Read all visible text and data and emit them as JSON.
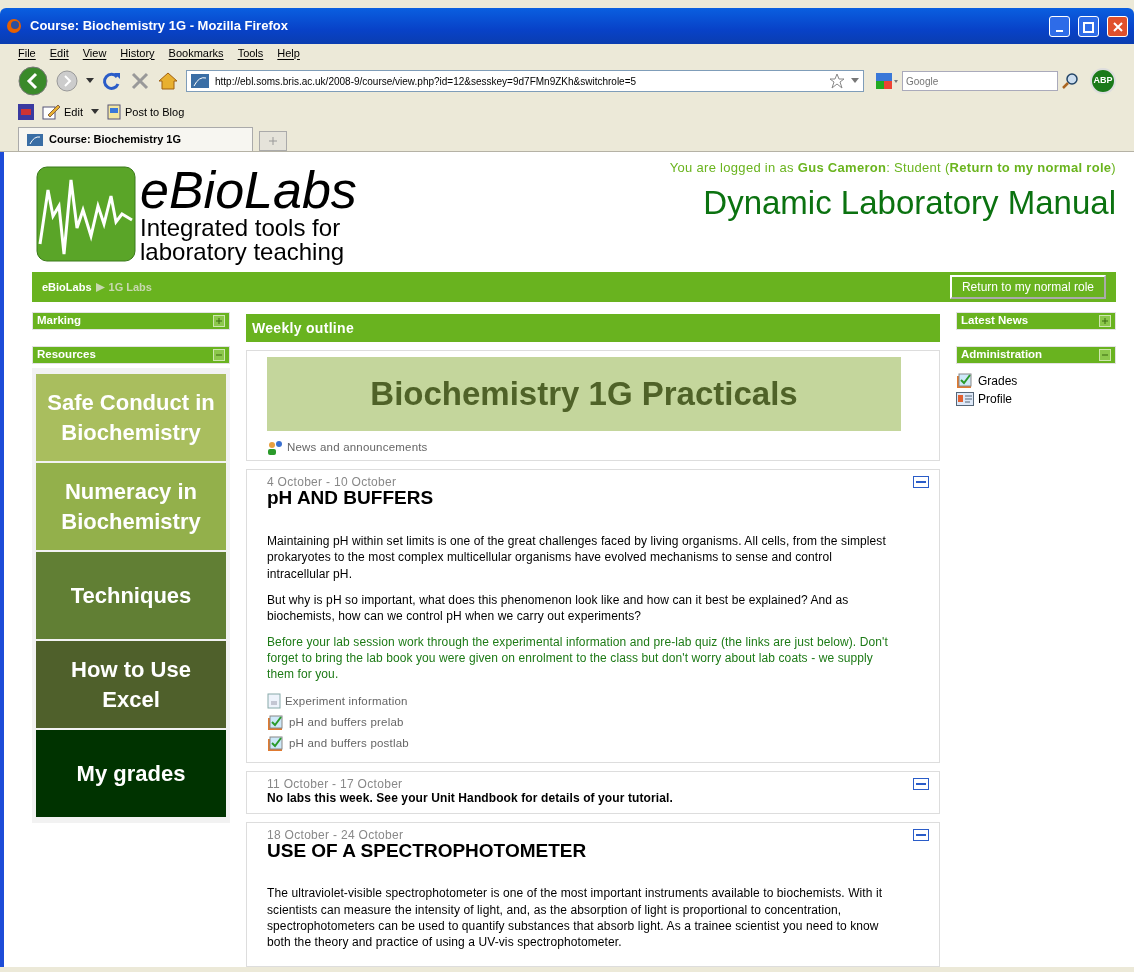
{
  "window": {
    "title": "Course: Biochemistry 1G - Mozilla Firefox"
  },
  "menu": [
    "File",
    "Edit",
    "View",
    "History",
    "Bookmarks",
    "Tools",
    "Help"
  ],
  "toolbar": {
    "url": "http://ebl.soms.bris.ac.uk/2008-9/course/view.php?id=12&sesskey=9d7FMn9ZKh&switchrole=5",
    "search_placeholder": "Google",
    "addon": "ABP"
  },
  "bookmarks": [
    "Edit",
    "Post to Blog"
  ],
  "tabs": [
    {
      "label": "Course: Biochemistry 1G",
      "selected": true
    }
  ],
  "header": {
    "logo_title": "eBioLabs",
    "logo_tagline": [
      "Integrated tools for",
      "laboratory teaching"
    ],
    "login": "You are logged in as **Gus Cameron**: Student (**Return to my normal role**)",
    "site_title": "Dynamic Laboratory Manual"
  },
  "breadcrumb": [
    "eBioLabs",
    "1G Labs"
  ],
  "role_button": "Return to my normal role",
  "left_blocks": [
    {
      "title": "Marking",
      "expanded": false
    },
    {
      "title": "Resources",
      "expanded": true,
      "tiles": [
        {
          "label": "Safe Conduct in Biochemistry",
          "color": "#a9be5e"
        },
        {
          "label": "Numeracy in Biochemistry",
          "color": "#93b04b"
        },
        {
          "label": "Techniques",
          "color": "#617f34"
        },
        {
          "label": "How to Use Excel",
          "color": "#4f602b"
        },
        {
          "label": "My grades",
          "color": "#003300"
        }
      ]
    }
  ],
  "outline": {
    "heading": "Weekly outline",
    "banner": "Biochemistry 1G Practicals",
    "news": "News and announcements",
    "sections": [
      {
        "dates": "4 October - 10 October",
        "title": "pH AND BUFFERS",
        "paragraphs": [
          {
            "kind": "plain",
            "text": "Maintaining pH within set limits is one of the great challenges faced by living organisms. All cells, from the simplest prokaryotes to the most complex multicellular organisms have evolved mechanisms to sense and control intracellular pH."
          },
          {
            "kind": "plain",
            "text": "But why is pH so important, what does this phenomenon look like and how can it best be explained? And as biochemists, how can we control pH when we carry out experiments?"
          },
          {
            "kind": "notice",
            "text": "Before your lab session work through the experimental information and pre-lab quiz (the links are just below). Don't forget to bring the lab book you were given on enrolment to the class but don't worry about lab coats - we supply them for you."
          }
        ],
        "activities": [
          {
            "kind": "page",
            "label": "Experiment information"
          },
          {
            "kind": "quiz",
            "label": "pH and buffers prelab"
          },
          {
            "kind": "quiz",
            "label": "pH and buffers postlab"
          }
        ]
      },
      {
        "dates": "11 October - 17 October",
        "paragraphs": [
          {
            "kind": "note",
            "text": "No labs this week. See your Unit Handbook for details of your tutorial."
          }
        ]
      },
      {
        "dates": "18 October - 24 October",
        "title": "USE OF A SPECTROPHOTOMETER",
        "paragraphs": [
          {
            "kind": "plain",
            "text": "The ultraviolet-visible spectrophotometer is one of the most important instruments available to biochemists. With it scientists can measure the intensity of light, and, as the absorption of light is proportional to concentration, spectrophotometers can be used to quantify substances that absorb light. As a trainee scientist you need to know both the theory and practice of using a UV-vis spectrophotometer."
          }
        ]
      }
    ]
  },
  "right_blocks": [
    {
      "title": "Latest News",
      "expanded": false
    },
    {
      "title": "Administration",
      "expanded": true,
      "items": [
        {
          "kind": "grades",
          "label": "Grades"
        },
        {
          "kind": "profile",
          "label": "Profile"
        }
      ]
    }
  ]
}
